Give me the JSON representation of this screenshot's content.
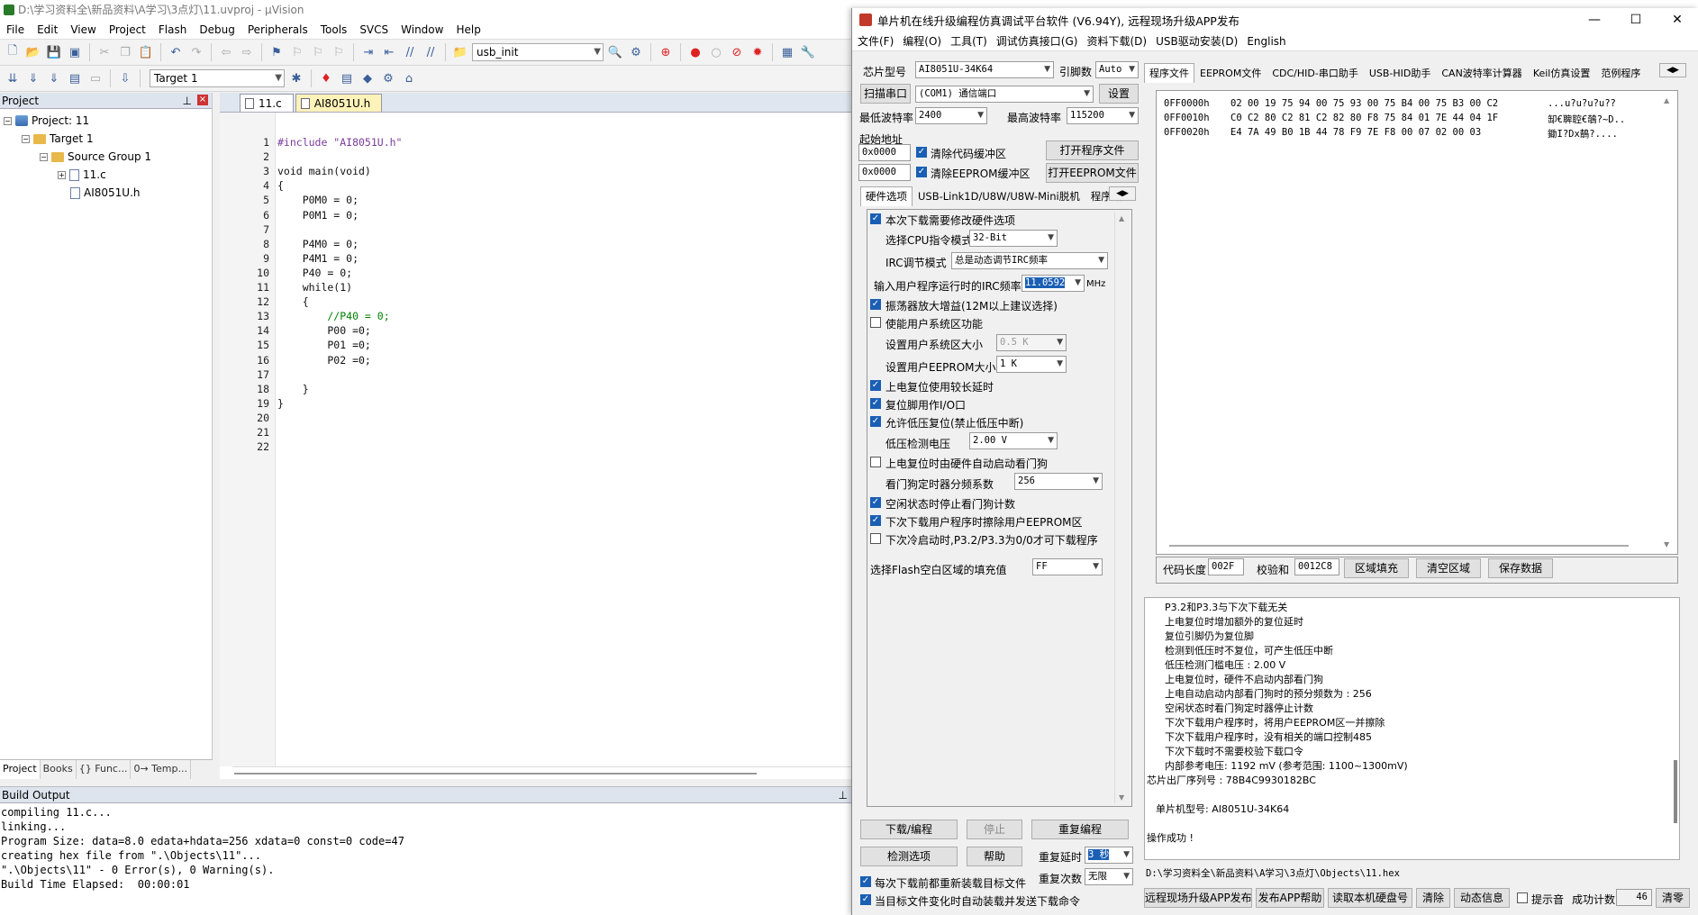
{
  "ide": {
    "title": "D:\\学习资料全\\新品资料\\A学习\\3点灯\\11.uvproj - µVision",
    "menu": [
      "File",
      "Edit",
      "View",
      "Project",
      "Flash",
      "Debug",
      "Peripherals",
      "Tools",
      "SVCS",
      "Window",
      "Help"
    ],
    "toolbar_combo": "usb_init",
    "target_combo": "Target 1",
    "project_panel": {
      "title": "Project",
      "tree": [
        "Project: 11",
        "Target 1",
        "Source Group 1",
        "11.c",
        "AI8051U.h"
      ],
      "tabs": [
        "Project",
        "Books",
        "{} Func...",
        "0→ Temp..."
      ]
    },
    "editor": {
      "tabs": [
        "11.c",
        "AI8051U.h"
      ],
      "line_numbers": [
        "1",
        "2",
        "3",
        "4",
        "5",
        "6",
        "7",
        "8",
        "9",
        "10",
        "11",
        "12",
        "13",
        "14",
        "15",
        "16",
        "17",
        "18",
        "19",
        "20",
        "21",
        "22"
      ],
      "code": [
        "#include \"AI8051U.h\"",
        "",
        "void main(void)",
        "{",
        "    P0M0 = 0;",
        "    P0M1 = 0;",
        "",
        "    P4M0 = 0;",
        "    P4M1 = 0;",
        "    P40 = 0;",
        "    while(1)",
        "    {",
        "        //P40 = 0;",
        "        P00 =0;",
        "        P01 =0;",
        "        P02 =0;",
        "",
        "    }",
        "}",
        "",
        "",
        ""
      ]
    },
    "build_output": {
      "title": "Build Output",
      "text": "compiling 11.c...\nlinking...\nProgram Size: data=8.0 edata+hdata=256 xdata=0 const=0 code=47\ncreating hex file from \".\\Objects\\11\"...\n\".\\Objects\\11\" - 0 Error(s), 0 Warning(s).\nBuild Time Elapsed:  00:00:01"
    }
  },
  "stc": {
    "title": "单片机在线升级编程仿真调试平台软件 (V6.94Y), 远程现场升级APP发布",
    "menu": [
      "文件(F)",
      "编程(O)",
      "工具(T)",
      "调试仿真接口(G)",
      "资料下载(D)",
      "USB驱动安装(D)",
      "English"
    ],
    "chip_label": "芯片型号",
    "chip_value": "AI8051U-34K64",
    "pin_label": "引脚数",
    "pin_value": "Auto",
    "scan_button": "扫描串口",
    "port_value": "(COM1) 通信端口",
    "settings_button": "设置",
    "min_baud_label": "最低波特率",
    "min_baud": "2400",
    "max_baud_label": "最高波特率",
    "max_baud": "115200",
    "start_addr_label": "起始地址",
    "addr1": "0x0000",
    "addr2": "0x0000",
    "clear_code_label": "清除代码缓冲区",
    "clear_eeprom_label": "清除EEPROM缓冲区",
    "open_prog_button": "打开程序文件",
    "open_eeprom_button": "打开EEPROM文件",
    "hw_tabs": [
      "硬件选项",
      "USB-Link1D/U8W/U8W-Mini脱机",
      "程序加"
    ],
    "options": [
      {
        "label": "本次下载需要修改硬件选项",
        "checked": true
      },
      {
        "label": "选择CPU指令模式",
        "value": "32-Bit"
      },
      {
        "label": "IRC调节模式",
        "value": "总是动态调节IRC频率"
      },
      {
        "label": "输入用户程序运行时的IRC频率",
        "value": "11.0592",
        "unit": "MHz"
      },
      {
        "label": "振荡器放大增益(12M以上建议选择)",
        "checked": true
      },
      {
        "label": "使能用户系统区功能",
        "checked": false
      },
      {
        "label": "设置用户系统区大小",
        "value": "0.5 K"
      },
      {
        "label": "设置用户EEPROM大小",
        "value": "1  K"
      },
      {
        "label": "上电复位使用较长延时",
        "checked": true
      },
      {
        "label": "复位脚用作I/O口",
        "checked": true
      },
      {
        "label": "允许低压复位(禁止低压中断)",
        "checked": true
      },
      {
        "label": "低压检测电压",
        "value": "2.00 V"
      },
      {
        "label": "上电复位时由硬件自动启动看门狗",
        "checked": false
      },
      {
        "label": "看门狗定时器分频系数",
        "value": "256"
      },
      {
        "label": "空闲状态时停止看门狗计数",
        "checked": true
      },
      {
        "label": "下次下载用户程序时擦除用户EEPROM区",
        "checked": true
      },
      {
        "label": "下次冷启动时,P3.2/P3.3为0/0才可下载程序",
        "checked": false
      },
      {
        "label": "选择Flash空白区域的填充值",
        "value": "FF"
      }
    ],
    "download_button": "下载/编程",
    "stop_button": "停止",
    "reprogram_button": "重复编程",
    "detect_button": "检测选项",
    "help_button": "帮助",
    "repeat_delay_label": "重复延时",
    "repeat_delay": "3 秒",
    "repeat_count_label": "重复次数",
    "repeat_count": "无限",
    "reload_label": "每次下载前都重新装载目标文件",
    "auto_send_label": "当目标文件变化时自动装载并发送下载命令",
    "right_tabs": [
      "程序文件",
      "EEPROM文件",
      "CDC/HID-串口助手",
      "USB-HID助手",
      "CAN波特率计算器",
      "Keil仿真设置",
      "范例程序"
    ],
    "hex_lines": [
      {
        "addr": "0FF0000h",
        "bytes": "02 00 19 75 94 00 75 93 00 75 B4 00 75 B3 00 C2",
        "ascii": "...u?u?u?u??"
      },
      {
        "addr": "0FF0010h",
        "bytes": "C0 C2 80 C2 81 C2 82 80 F8 75 84 01 7E 44 04 1F",
        "ascii": "缷€聛聜€鵸?~D.."
      },
      {
        "addr": "0FF0020h",
        "bytes": "E4 7A 49 B0 1B 44 78 F9 7E F8 00 07 02 00 03",
        "ascii": "鋤I?Dx鶄?...."
      }
    ],
    "code_len_label": "代码长度",
    "code_len": "002F",
    "checksum_label": "校验和",
    "checksum": "0012C8",
    "fill_button": "区域填充",
    "clear_region_button": "清空区域",
    "save_button": "保存数据",
    "log_lines": [
      "P3.2和P3.3与下次下载无关",
      "上电复位时增加额外的复位延时",
      "复位引脚仍为复位脚",
      "检测到低压时不复位，可产生低压中断",
      "低压检测门槛电压 : 2.00 V",
      "上电复位时，硬件不启动内部看门狗",
      "上电自动启动内部看门狗时的预分频数为 : 256",
      "空闲状态时看门狗定时器停止计数",
      "下次下载用户程序时，将用户EEPROM区一并擦除",
      "下次下载用户程序时，没有相关的端口控制485",
      "下次下载时不需要校验下载口令",
      "内部参考电压: 1192 mV (参考范围: 1100~1300mV)"
    ],
    "serial_line": "芯片出厂序列号 : 78B4C9930182BC",
    "chip_model_line": "单片机型号: AI8051U-34K64",
    "success_line": "操作成功 !",
    "hex_path": "D:\\学习资料全\\新品资料\\A学习\\3点灯\\Objects\\11.hex",
    "bottom_buttons": [
      "远程现场升级APP发布",
      "发布APP帮助",
      "读取本机硬盘号",
      "清除",
      "动态信息"
    ],
    "tip_label": "提示音",
    "success_count_label": "成功计数",
    "success_count": "46",
    "clear_count_button": "清零"
  }
}
